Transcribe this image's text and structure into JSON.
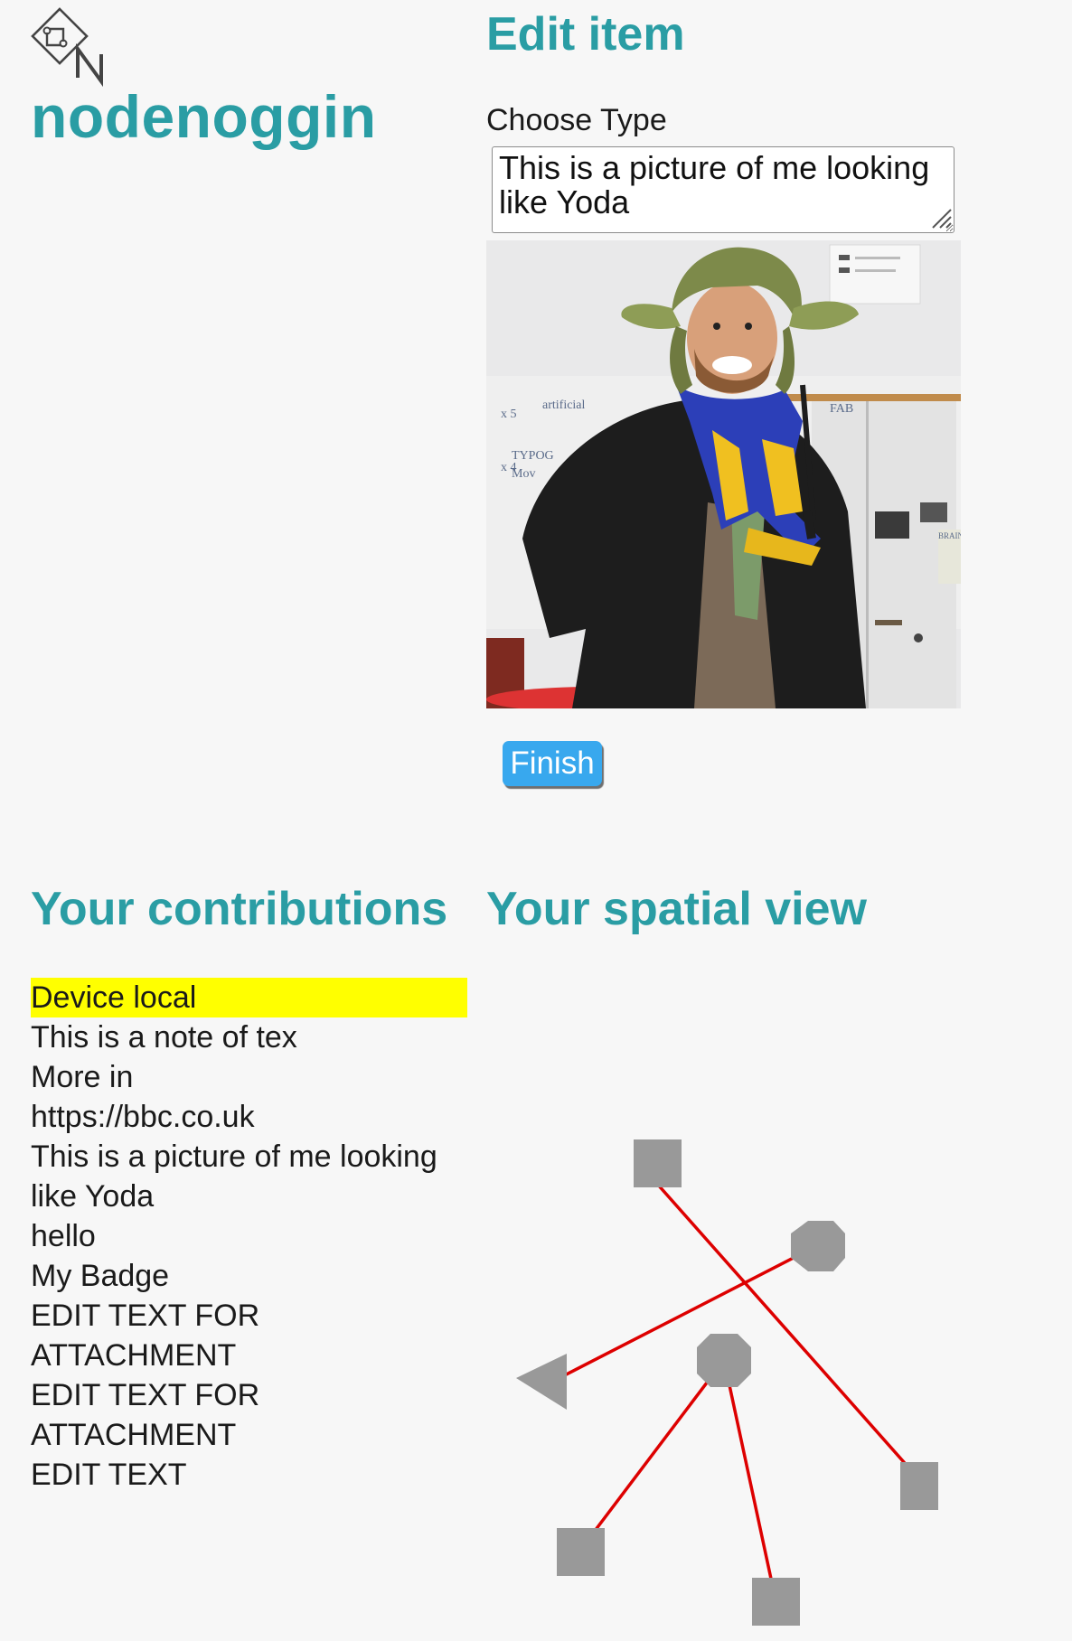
{
  "brand": {
    "name": "nodenoggin",
    "logo_icon": "nodenoggin-logo-icon",
    "color": "#2a9da4"
  },
  "edit": {
    "title": "Edit item",
    "choose_type_label": "Choose Type",
    "description_value": "This is a picture of me looking like Yoda",
    "photo_icon": "person-in-yoda-hat-photo",
    "finish_label": "Finish",
    "finish_color": "#38a8ee"
  },
  "contributions": {
    "title": "Your contributions",
    "highlight_color": "#ffff00",
    "items": [
      {
        "label": "Device local",
        "selected": true
      },
      {
        "label": "This is a note of tex"
      },
      {
        "label": "More in"
      },
      {
        "label": "https://bbc.co.uk"
      },
      {
        "label": "This is a picture of me looking like Yoda"
      },
      {
        "label": "hello"
      },
      {
        "label": "My Badge"
      },
      {
        "label": "EDIT TEXT FOR ATTACHMENT"
      },
      {
        "label": "EDIT TEXT FOR ATTACHMENT"
      },
      {
        "label": "EDIT TEXT"
      }
    ]
  },
  "spatial": {
    "title": "Your spatial view",
    "node_color": "#999999",
    "link_color": "#dd0000",
    "node_shapes": [
      "square",
      "octagon",
      "octagon",
      "triangle",
      "square",
      "square",
      "square"
    ]
  }
}
